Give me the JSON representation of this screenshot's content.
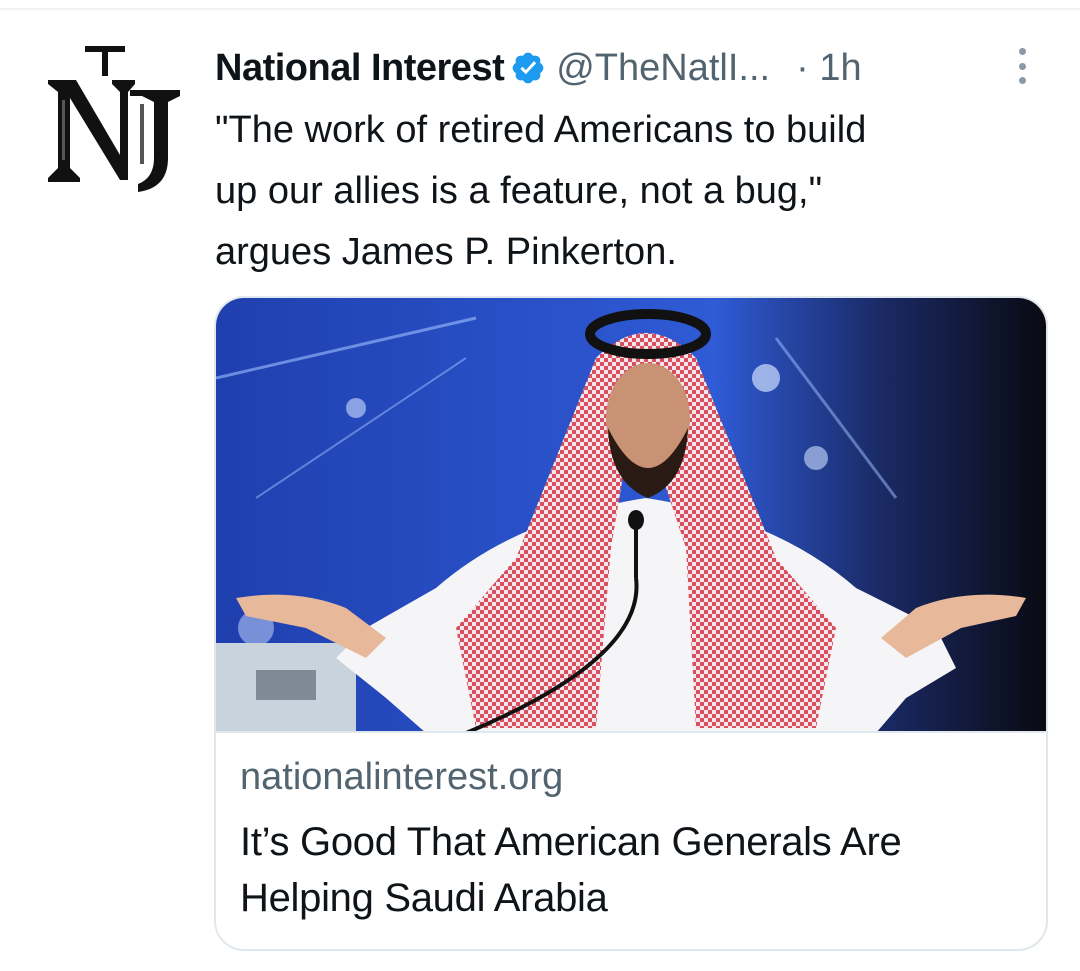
{
  "tweet": {
    "author": {
      "display_name": "National Interest",
      "handle": "@TheNatlI...",
      "verified": true,
      "avatar_icon": "national-interest-logo"
    },
    "timestamp": "· 1h",
    "more_icon": "more-options-icon",
    "text_lines": [
      "\"The work of retired Americans to build",
      "up our allies is a feature, not a bug,\"",
      "argues James P. Pinkerton."
    ],
    "card": {
      "domain": "nationalinterest.org",
      "title_lines": [
        "It’s Good That American Generals Are",
        "Helping Saudi Arabia"
      ]
    }
  },
  "colors": {
    "text_primary": "#0f1419",
    "text_secondary": "#536471",
    "verified_blue": "#1d9bf0",
    "card_border": "#e1e8ed"
  }
}
